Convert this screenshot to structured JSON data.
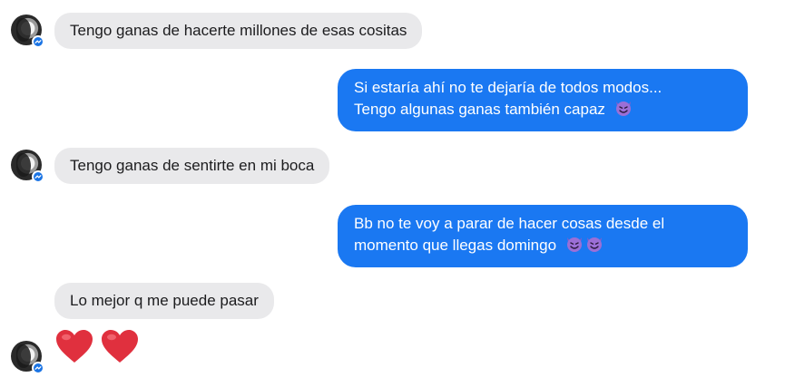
{
  "conversation": {
    "messages": [
      {
        "direction": "incoming",
        "text": "Tengo ganas de hacerte millones de esas cositas"
      },
      {
        "direction": "outgoing",
        "lines": [
          "Si estaría ahí no te dejaría de todos modos...",
          "Tengo algunas ganas también capaz"
        ],
        "emojis": [
          "smiling-devil"
        ]
      },
      {
        "direction": "incoming",
        "text": "Tengo ganas de sentirte en mi boca"
      },
      {
        "direction": "outgoing",
        "lines": [
          "Bb no te voy a parar de hacer cosas desde el",
          "momento que llegas domingo"
        ],
        "emojis": [
          "smiling-devil",
          "smiling-devil"
        ]
      },
      {
        "direction": "incoming",
        "text": "Lo mejor q me puede pasar"
      },
      {
        "direction": "incoming",
        "emojis": [
          "red-heart",
          "red-heart"
        ]
      }
    ]
  },
  "theme": {
    "incoming_bubble": "#e9e9eb",
    "outgoing_bubble": "#1a78f2",
    "messenger_badge": "#1b74e4",
    "heart": "#e0303e",
    "devil": "#9b6fd6"
  },
  "icons": {
    "avatar_badge": "messenger-icon",
    "devil": "smiling-face-with-horns-icon",
    "heart": "red-heart-icon"
  }
}
